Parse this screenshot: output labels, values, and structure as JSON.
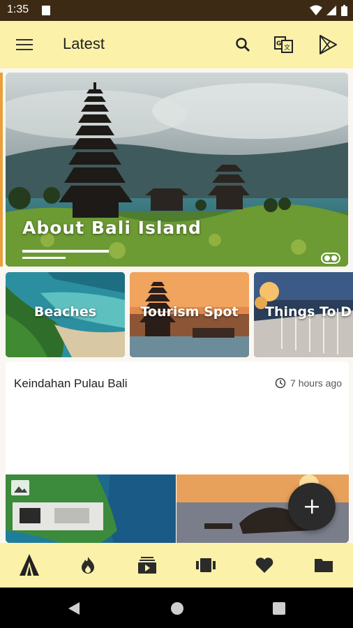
{
  "status_bar": {
    "time": "1:35"
  },
  "app_bar": {
    "title": "Latest"
  },
  "hero": {
    "caption": "About Bali Island"
  },
  "categories": [
    {
      "label": "Beaches"
    },
    {
      "label": "Tourism Spot"
    },
    {
      "label": "Things To D"
    }
  ],
  "post": {
    "title": "Keindahan Pulau Bali",
    "time": "7 hours ago"
  },
  "colors": {
    "accent": "#fbf1a9",
    "status_bar": "#3c2a14",
    "fab": "#2b2b2b"
  },
  "bottom_nav": [
    {
      "icon": "temple-icon",
      "active": true
    },
    {
      "icon": "flame-icon"
    },
    {
      "icon": "video-stack-icon"
    },
    {
      "icon": "carousel-icon"
    },
    {
      "icon": "heart-icon"
    },
    {
      "icon": "folder-icon"
    }
  ]
}
